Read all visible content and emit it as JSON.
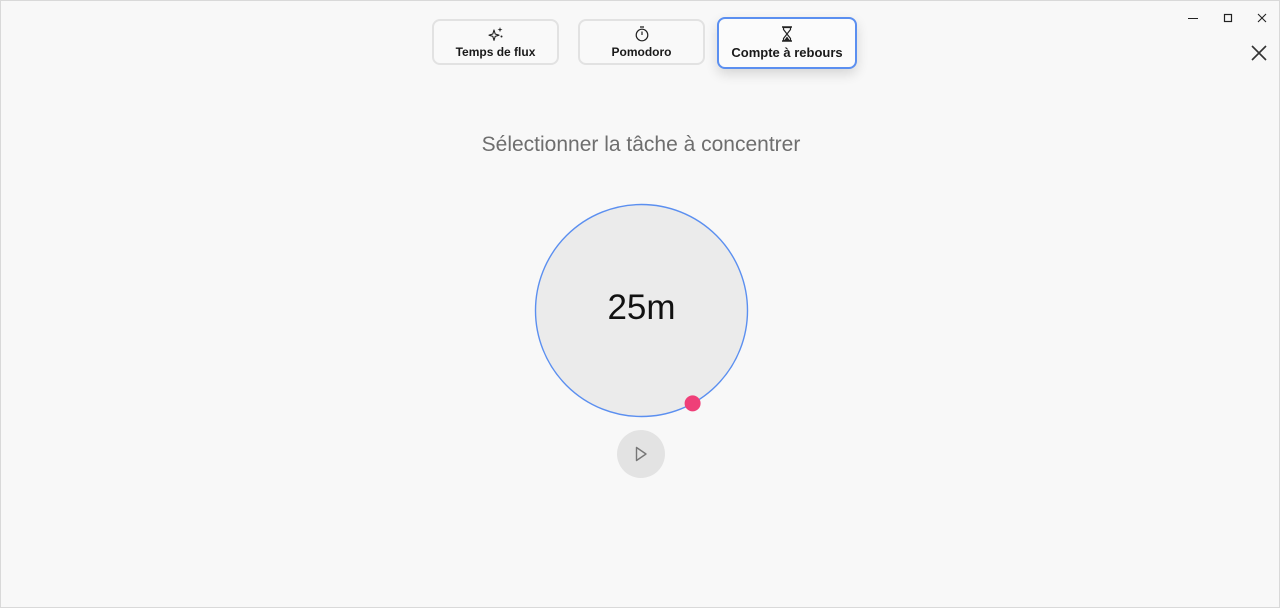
{
  "window": {
    "controls": [
      "minimize",
      "maximize",
      "close"
    ]
  },
  "modes": {
    "flow_label": "Temps de flux",
    "pomodoro_label": "Pomodoro",
    "countdown_label": "Compte à rebours",
    "selected": "countdown"
  },
  "task": {
    "prompt": "Sélectionner la tâche à concentrer"
  },
  "timer": {
    "value": "25m",
    "progress_fraction": 0.42
  },
  "colors": {
    "accent": "#5b8ff0",
    "handle": "#ef3f78",
    "dial_fill": "#ebebeb"
  },
  "icons": {
    "flow": "sparkle-icon",
    "pomodoro": "stopwatch-icon",
    "countdown": "hourglass-icon",
    "play": "play-icon",
    "close": "close-icon"
  }
}
